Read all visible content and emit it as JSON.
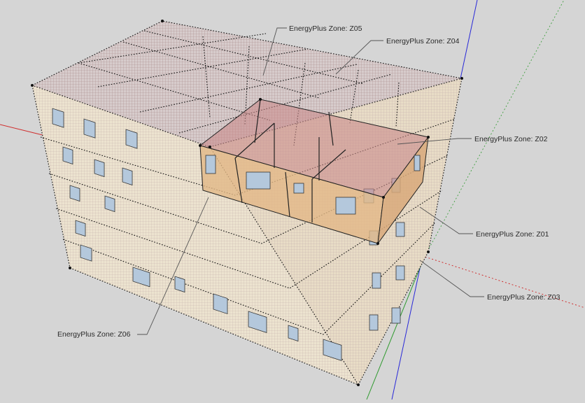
{
  "scene": {
    "colors": {
      "background": "#d5d5d5",
      "facade": "#ece3cf",
      "mesh": "#b89a9a",
      "zone_floor": "#c98b8b",
      "zone_wall": "#e2b886",
      "window": "#b4c8dc",
      "axis_red": "#d03030",
      "axis_green": "#2e9a2e",
      "axis_blue": "#2828d8"
    }
  },
  "labels": {
    "z05": "EnergyPlus Zone:  Z05",
    "z04": "EnergyPlus Zone:  Z04",
    "z02": "EnergyPlus Zone:  Z02",
    "z01": "EnergyPlus Zone:  Z01",
    "z03": "EnergyPlus Zone:  Z03",
    "z06": "EnergyPlus Zone:  Z06"
  }
}
